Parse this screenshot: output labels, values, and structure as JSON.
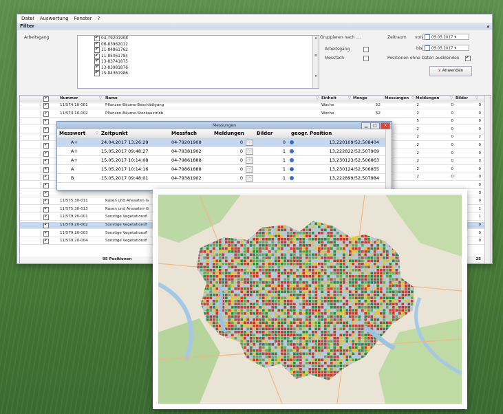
{
  "menu": [
    "Datei",
    "Auswertung",
    "Fenster",
    "?"
  ],
  "filter": {
    "title": "Filter",
    "arbeitsgang_label": "Arbeitsgang",
    "arbeitsgang_items": [
      "04-79201908",
      "06-83962012",
      "11-84861762",
      "11-85061784",
      "13-83741875",
      "13-83981876",
      "15-84361986"
    ],
    "gruppieren_label": "Gruppieren nach ....",
    "group_arbeitsgang": "Arbeitsgang",
    "group_messfach": "Messfach",
    "zeitraum_label": "Zeitraum",
    "von_label": "von",
    "bis_label": "bis",
    "von_date": "09.05.2017",
    "bis_date": "09.05.2017",
    "positionen_label": "Positionen ohne Daten ausblenden",
    "anwenden": "Anwenden"
  },
  "grid": {
    "headers": [
      "Nummer",
      "Name",
      "Einheit",
      "Menge",
      "Messungen",
      "Meldungen",
      "Bilder"
    ],
    "rows": [
      {
        "nummer": "11/574.10-001",
        "name": "Pflanzen-Bäume-Beschädigung",
        "einheit": "Woche",
        "menge": "52",
        "messungen": "2",
        "meldungen": "0",
        "bilder": "0"
      },
      {
        "nummer": "11/574.10-002",
        "name": "Pflanzen-Bäume-Stockaustrieb",
        "einheit": "Woche",
        "menge": "52",
        "messungen": "2",
        "meldungen": "0",
        "bilder": "0"
      },
      {
        "nummer": "",
        "name": "",
        "einheit": "",
        "menge": "",
        "messungen": "5",
        "meldungen": "0",
        "bilder": "0"
      },
      {
        "nummer": "",
        "name": "",
        "einheit": "",
        "menge": "",
        "messungen": "2",
        "meldungen": "0",
        "bilder": "0"
      },
      {
        "nummer": "",
        "name": "",
        "einheit": "",
        "menge": "",
        "messungen": "2",
        "meldungen": "0",
        "bilder": "2"
      },
      {
        "nummer": "",
        "name": "",
        "einheit": "",
        "menge": "",
        "messungen": "2",
        "meldungen": "0",
        "bilder": "0"
      },
      {
        "nummer": "",
        "name": "",
        "einheit": "",
        "menge": "",
        "messungen": "2",
        "meldungen": "0",
        "bilder": "0"
      },
      {
        "nummer": "",
        "name": "",
        "einheit": "",
        "menge": "",
        "messungen": "2",
        "meldungen": "0",
        "bilder": "0"
      },
      {
        "nummer": "",
        "name": "",
        "einheit": "",
        "menge": "",
        "messungen": "2",
        "meldungen": "0",
        "bilder": "0"
      },
      {
        "nummer": "",
        "name": "",
        "einheit": "",
        "menge": "",
        "messungen": "2",
        "meldungen": "0",
        "bilder": "0"
      },
      {
        "nummer": "11/575.30-009",
        "name": "Rasen und Ansaaten-G",
        "einheit": "",
        "menge": "",
        "messungen": "",
        "meldungen": "",
        "bilder": "0"
      },
      {
        "nummer": "",
        "name": "",
        "einheit": "",
        "menge": "",
        "messungen": "",
        "meldungen": "",
        "bilder": "0"
      },
      {
        "nummer": "11/575.30-011",
        "name": "Rasen und Ansaaten-G",
        "einheit": "",
        "menge": "",
        "messungen": "",
        "meldungen": "",
        "bilder": "0"
      },
      {
        "nummer": "11/575.30-013",
        "name": "Rasen und Ansaaten-G",
        "einheit": "",
        "menge": "",
        "messungen": "",
        "meldungen": "",
        "bilder": "1"
      },
      {
        "nummer": "11/579.20-001",
        "name": "Sonstige Vegetationsfl",
        "einheit": "",
        "menge": "",
        "messungen": "",
        "meldungen": "",
        "bilder": "1"
      },
      {
        "nummer": "11/579.20-002",
        "name": "Sonstige Vegetationsfl",
        "einheit": "",
        "menge": "",
        "messungen": "",
        "meldungen": "",
        "bilder": "0"
      },
      {
        "nummer": "11/579.20-003",
        "name": "Sonstige Vegetationsfl",
        "einheit": "",
        "menge": "",
        "messungen": "",
        "meldungen": "",
        "bilder": "0"
      },
      {
        "nummer": "11/579.20-004",
        "name": "Sonstige Vegetationsfl",
        "einheit": "",
        "menge": "",
        "messungen": "",
        "meldungen": "",
        "bilder": "0"
      }
    ],
    "footer_positions": "95 Positionen",
    "footer_bilder": "25"
  },
  "popup": {
    "title": "Messungen",
    "headers": [
      "Messwert",
      "Zeitpunkt",
      "Messfach",
      "Meldungen",
      "Bilder",
      "geogr. Position"
    ],
    "rows": [
      {
        "messwert": "A+",
        "zeit": "24.04.2017 13:26:29",
        "messfach": "04-79201908",
        "meldungen": "0",
        "bilder": "0",
        "pos": "13,220109/52,508404"
      },
      {
        "messwert": "A+",
        "zeit": "15.05.2017 09:48:27",
        "messfach": "04-79381902",
        "meldungen": "0",
        "bilder": "1",
        "pos": "13,222822/52,507969"
      },
      {
        "messwert": "A+",
        "zeit": "15.05.2017 10:14:08",
        "messfach": "04-79861888",
        "meldungen": "0",
        "bilder": "1",
        "pos": "13,230123/52,506863"
      },
      {
        "messwert": "A",
        "zeit": "15.05.2017 10:14:16",
        "messfach": "04-79861888",
        "meldungen": "0",
        "bilder": "1",
        "pos": "13,230124/52,506855"
      },
      {
        "messwert": "B",
        "zeit": "15.05.2017 09:48:01",
        "messfach": "04-79381902",
        "meldungen": "0",
        "bilder": "1",
        "pos": "13,222899/52,507984"
      }
    ]
  },
  "colors": {
    "selection": "#c6d8f0",
    "accent": "#3a6fc4",
    "cell_red": "#d23a2a",
    "cell_green": "#2e8b3a",
    "cell_yellow": "#e0c23a"
  }
}
